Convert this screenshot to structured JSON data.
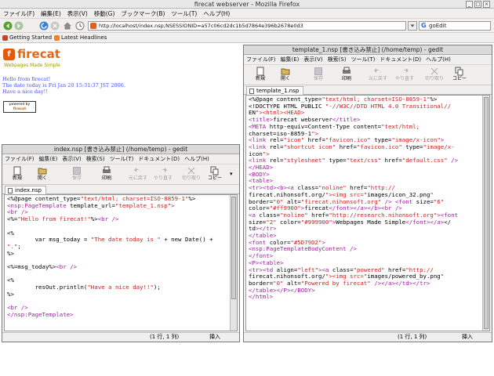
{
  "firefox": {
    "title": "firecat webserver - Mozilla Firefox",
    "menu": [
      "ファイル(F)",
      "編集(E)",
      "表示(V)",
      "移動(G)",
      "ブックマーク(B)",
      "ツール(T)",
      "ヘルプ(H)"
    ],
    "url": "http://localhost/index.nsp;NSESSIONID=a57c06cd2dc1b5d7864e396b2678e0d3",
    "search_engine": "G",
    "search_text": "goEdit",
    "bookmarks": [
      "Getting Started",
      "Latest Headlines"
    ]
  },
  "page": {
    "logo_mark": "f",
    "logo_text": "firecat",
    "logo_tagline": "Webpages Made Simple",
    "hello": "Hello from firecat!",
    "date_line": "The date today is Fri Jan 20 15:31:37 JST 2006.",
    "nice_day": "Have a nice day!!",
    "powered_line1": "powered by",
    "powered_line2": "firecat"
  },
  "gedit_left": {
    "title": "index.nsp [書き込み禁止] (/home/temp) - gedit",
    "menu": [
      "ファイル(F)",
      "編集(E)",
      "表示(V)",
      "検索(S)",
      "ツール(T)",
      "ドキュメント(D)",
      "ヘルプ(H)"
    ],
    "toolbar": [
      "新規",
      "開く",
      "保存",
      "印刷",
      "元に戻す",
      "やり直す",
      "切り取り",
      "コピー"
    ],
    "tab": "index.nsp",
    "code": [
      "<%@page content_type=\"text/html; charset=ISO-8859-1\"%>",
      "<nsp:PageTemplate template_url=\"template_1.nsp\">",
      "<br />",
      "<%=\"Hello from firecat!\"%><br />",
      "",
      "<%",
      "        var msg_today = \"The date today is \" + new Date() +",
      "\".\";",
      "%>",
      "",
      "<%=msg_today%><br />",
      "",
      "<%",
      "        resOut.println(\"Have a nice day!!\");",
      "%>",
      "",
      "<br />",
      "</nsp:PageTemplate>"
    ],
    "status_pos": "(1 行, 1 列)",
    "status_mode": "挿入"
  },
  "gedit_right": {
    "title": "template_1.nsp [書き込み禁止] (/home/temp) - gedit",
    "menu": [
      "ファイル(F)",
      "編集(E)",
      "表示(V)",
      "検索(S)",
      "ツール(T)",
      "ドキュメント(D)",
      "ヘルプ(H)"
    ],
    "toolbar": [
      "新規",
      "開く",
      "保存",
      "印刷",
      "元に戻す",
      "やり直す",
      "切り取り",
      "コピー"
    ],
    "tab": "template_1.nsp",
    "code": [
      "<%@page content_type=\"text/html; charset=ISO-8859-1\"%>",
      "<!DOCTYPE HTML PUBLIC \"-//W3C//DTD HTML 4.0 Transitional//",
      "EN\"><html><HEAD>",
      "<title>firecat webserver</title>",
      "<META http-equiv=Content-Type content=\"text/html;",
      "charset=iso-8859-1\">",
      "<link rel=\"icon\" href=\"favicon.ico\" type=\"image/x-icon\">",
      "<link rel=\"shortcut icon\" href=\"favicon.ico\" type=\"image/x-",
      "icon\">",
      "<link rel=\"stylesheet\" type=\"text/css\" href=\"default.css\" />",
      "</HEAD>",
      "<BODY>",
      "<table>",
      "<tr><td><b><a class=\"noline\" href=\"http://",
      "firecat.nihonsoft.org/\"><img src=\"images/icon_32.png\"",
      "border=\"0\" alt=\"firecat.nihonsoft.org\" /> <font size=\"6\"",
      "color=\"#ff9900\">firecat</font></a></b><br />",
      "<a class=\"noline\" href=\"http://research.nihonsoft.org\"><font",
      "size=\"2\" color=\"#999900\">Webpages Made Simple</font></a></",
      "td></tr>",
      "</table>",
      "<font color=\"#5D79D2\">",
      "<nsp:PageTemplateBodyContent />",
      "</font>",
      "<P><table>",
      "<tr><td align=\"left\"><a class=\"powered\" href=\"http://",
      "firecat.nihonsoft.org/\"><img src=\"images/powered_by.png\"",
      "border=\"0\" alt=\"Powered by firecat\" /></a></td></tr>",
      "</table></P></BODY>",
      "</html>"
    ],
    "status_pos": "(1 行, 1 列)",
    "status_mode": "挿入"
  },
  "colors": {
    "logo": "#e06818",
    "tagline": "#999900",
    "body_text": "#4455ff",
    "tag": "#a020a0",
    "string": "#d02020",
    "keyword": "#2020d0"
  }
}
